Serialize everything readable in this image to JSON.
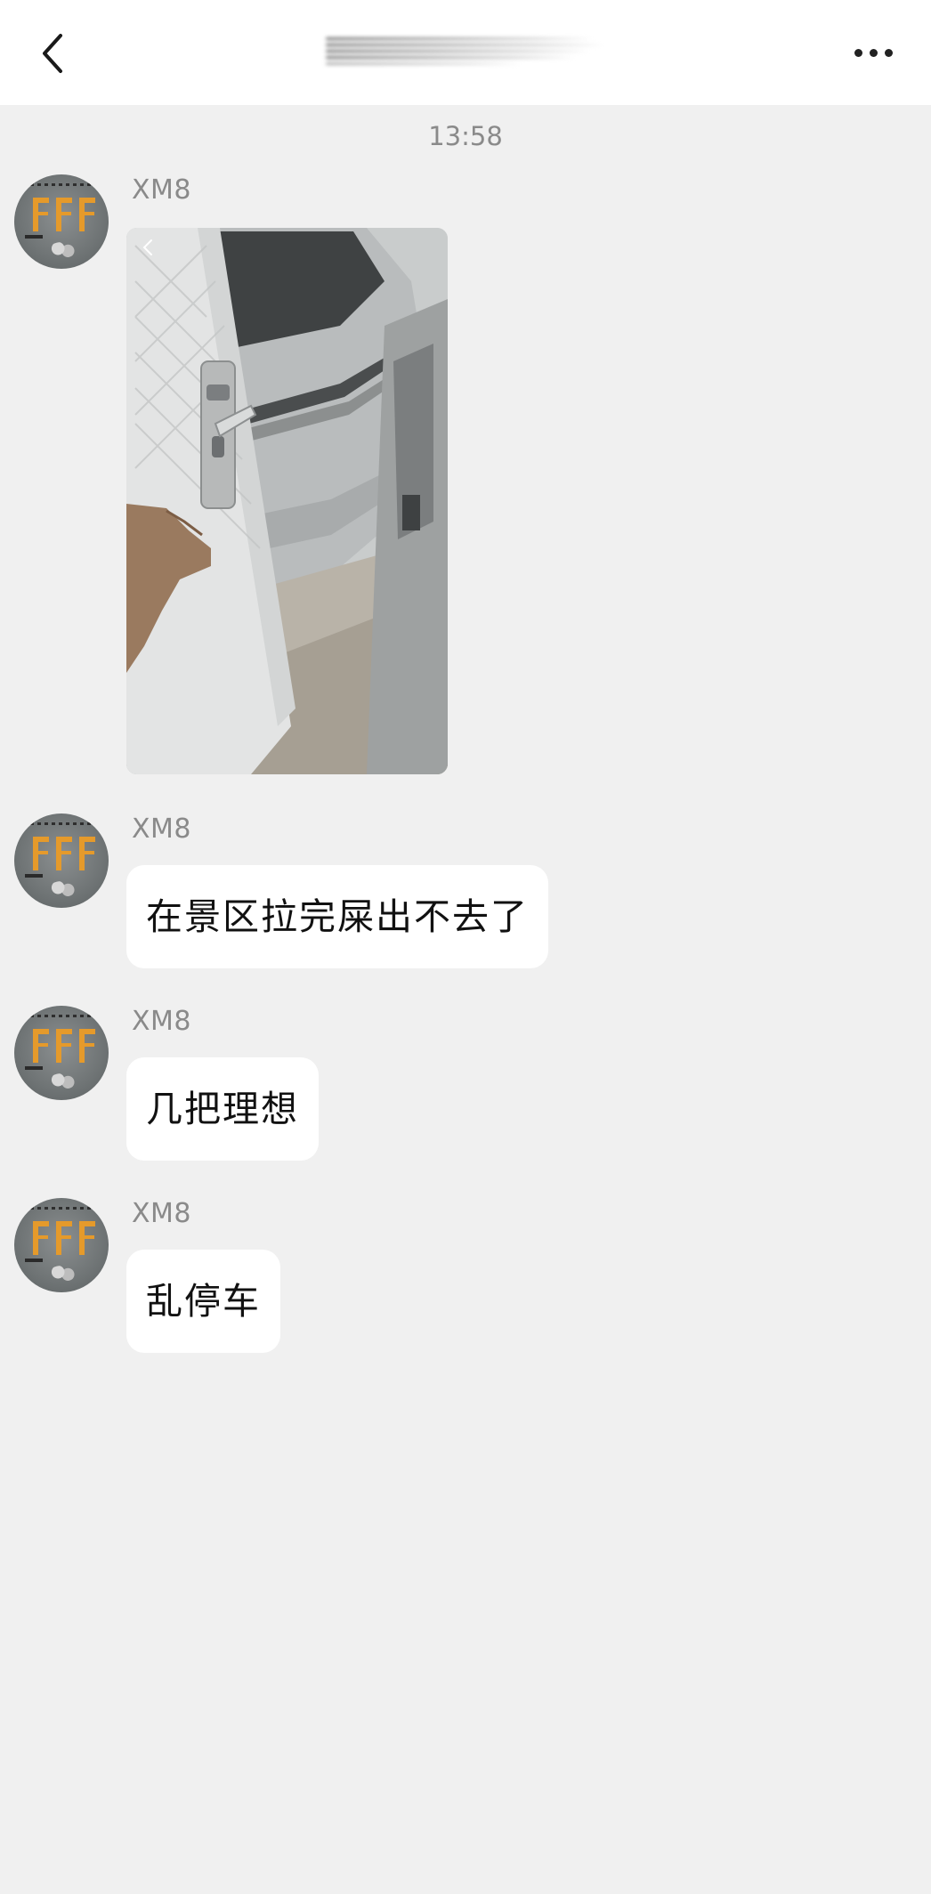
{
  "header": {
    "back_icon": "chevron-left-icon",
    "more_icon": "more-horizontal-icon"
  },
  "chat": {
    "timestamp": "13:58",
    "messages": [
      {
        "sender": "XM8",
        "type": "image",
        "image_icon": "shared-photo"
      },
      {
        "sender": "XM8",
        "type": "text",
        "text": "在景区拉完屎出不去了"
      },
      {
        "sender": "XM8",
        "type": "text",
        "text": "几把理想"
      },
      {
        "sender": "XM8",
        "type": "text",
        "text": "乱停车"
      }
    ]
  },
  "colors": {
    "background": "#f0f0f0",
    "bubble": "#ffffff",
    "meta_text": "#8a8a8a"
  }
}
